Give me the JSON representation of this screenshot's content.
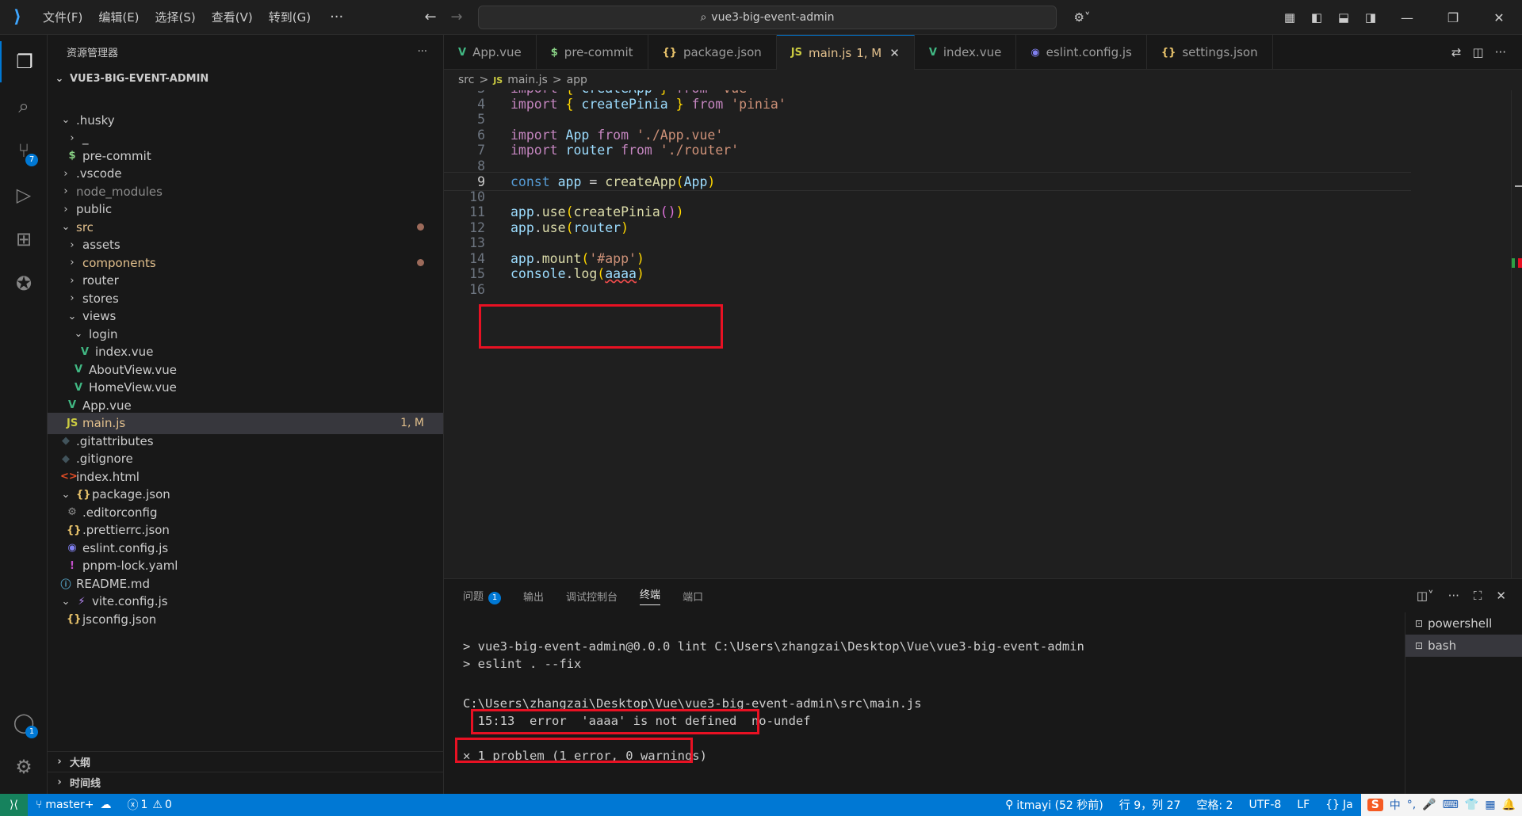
{
  "titlebar": {
    "menus": [
      "文件(F)",
      "编辑(E)",
      "选择(S)",
      "查看(V)",
      "转到(G)"
    ],
    "more": "···",
    "back_icon": "arrow-left-icon",
    "forward_icon": "arrow-right-icon",
    "search_text": "vue3-big-event-admin"
  },
  "activity": {
    "scm_badge": "7",
    "account_badge": "1"
  },
  "explorer": {
    "title": "资源管理器",
    "more": "···",
    "root": "VUE3-BIG-EVENT-ADMIN",
    "items": [
      {
        "label": ".husky",
        "depth": 1,
        "kind": "folder-open"
      },
      {
        "label": "_",
        "depth": 2,
        "kind": "folder"
      },
      {
        "label": "pre-commit",
        "depth": 2,
        "kind": "shell"
      },
      {
        "label": ".vscode",
        "depth": 1,
        "kind": "folder"
      },
      {
        "label": "node_modules",
        "depth": 1,
        "kind": "folder",
        "dim": true
      },
      {
        "label": "public",
        "depth": 1,
        "kind": "folder"
      },
      {
        "label": "src",
        "depth": 1,
        "kind": "folder-open",
        "modified": true,
        "dot": true
      },
      {
        "label": "assets",
        "depth": 2,
        "kind": "folder"
      },
      {
        "label": "components",
        "depth": 2,
        "kind": "folder",
        "modified": true,
        "dot": true
      },
      {
        "label": "router",
        "depth": 2,
        "kind": "folder"
      },
      {
        "label": "stores",
        "depth": 2,
        "kind": "folder"
      },
      {
        "label": "views",
        "depth": 2,
        "kind": "folder-open"
      },
      {
        "label": "login",
        "depth": 3,
        "kind": "folder-open"
      },
      {
        "label": "index.vue",
        "depth": 4,
        "kind": "vue"
      },
      {
        "label": "AboutView.vue",
        "depth": 3,
        "kind": "vue"
      },
      {
        "label": "HomeView.vue",
        "depth": 3,
        "kind": "vue"
      },
      {
        "label": "App.vue",
        "depth": 2,
        "kind": "vue"
      },
      {
        "label": "main.js",
        "depth": 2,
        "kind": "js",
        "modified": true,
        "selected": true,
        "status": "1, M"
      },
      {
        "label": ".gitattributes",
        "depth": 1,
        "kind": "git"
      },
      {
        "label": ".gitignore",
        "depth": 1,
        "kind": "git"
      },
      {
        "label": "index.html",
        "depth": 1,
        "kind": "html"
      },
      {
        "label": "package.json",
        "depth": 1,
        "kind": "json-open"
      },
      {
        "label": ".editorconfig",
        "depth": 2,
        "kind": "gear"
      },
      {
        "label": ".prettierrc.json",
        "depth": 2,
        "kind": "json"
      },
      {
        "label": "eslint.config.js",
        "depth": 2,
        "kind": "eslint"
      },
      {
        "label": "pnpm-lock.yaml",
        "depth": 2,
        "kind": "yaml"
      },
      {
        "label": "README.md",
        "depth": 1,
        "kind": "info"
      },
      {
        "label": "vite.config.js",
        "depth": 1,
        "kind": "vite-open"
      },
      {
        "label": "jsconfig.json",
        "depth": 2,
        "kind": "json"
      }
    ],
    "outline": "大纲",
    "timeline": "时间线"
  },
  "tabs": [
    {
      "label": "App.vue",
      "icon": "V",
      "color": "#41b883"
    },
    {
      "label": "pre-commit",
      "icon": "$",
      "color": "#89d185"
    },
    {
      "label": "package.json",
      "icon": "{}",
      "color": "#e8c36b"
    },
    {
      "label": "main.js",
      "icon": "JS",
      "color": "#cbcb41",
      "status": "1, M",
      "active": true,
      "close": "✕"
    },
    {
      "label": "index.vue",
      "icon": "V",
      "color": "#41b883"
    },
    {
      "label": "eslint.config.js",
      "icon": "◉",
      "color": "#8080f0"
    },
    {
      "label": "settings.json",
      "icon": "{}",
      "color": "#e8c36b"
    }
  ],
  "breadcrumb": [
    "src",
    ">",
    "JS",
    "main.js",
    ">",
    "app"
  ],
  "editor": {
    "lines": [
      {
        "n": "3",
        "html": "import { createApp } from 'vue'"
      },
      {
        "n": "4",
        "html": "import { createPinia } from 'pinia'"
      },
      {
        "n": "5",
        "html": ""
      },
      {
        "n": "6",
        "html": "import App from './App.vue'"
      },
      {
        "n": "7",
        "html": "import router from './router'"
      },
      {
        "n": "8",
        "html": ""
      },
      {
        "n": "9",
        "html": "const app = createApp(App)"
      },
      {
        "n": "10",
        "html": ""
      },
      {
        "n": "11",
        "html": "app.use(createPinia())"
      },
      {
        "n": "12",
        "html": "app.use(router)"
      },
      {
        "n": "13",
        "html": ""
      },
      {
        "n": "14",
        "html": "app.mount('#app')"
      },
      {
        "n": "15",
        "html": "console.log(aaaa)"
      },
      {
        "n": "16",
        "html": ""
      }
    ]
  },
  "panel": {
    "tabs": [
      "问题",
      "输出",
      "调试控制台",
      "终端",
      "端口"
    ],
    "problems_badge": "1",
    "terminal_lines": [
      "> vue3-big-event-admin@0.0.0 lint C:\\Users\\zhangzai\\Desktop\\Vue\\vue3-big-event-admin",
      "> eslint . --fix",
      "C:\\Users\\zhangzai\\Desktop\\Vue\\vue3-big-event-admin\\src\\main.js",
      "  15:13  error  'aaaa' is not defined  no-undef",
      "✕ 1 problem (1 error, 0 warnings)"
    ],
    "terminals": [
      "powershell",
      "bash"
    ]
  },
  "status": {
    "remote_icon": "remote-icon",
    "branch": "master+",
    "errors": "1",
    "warnings": "0",
    "author": "itmayi (52 秒前)",
    "position": "行 9，列 27",
    "spaces": "空格: 2",
    "encoding": "UTF-8",
    "eol": "LF",
    "lang": "Ja",
    "ime_lang": "中"
  }
}
